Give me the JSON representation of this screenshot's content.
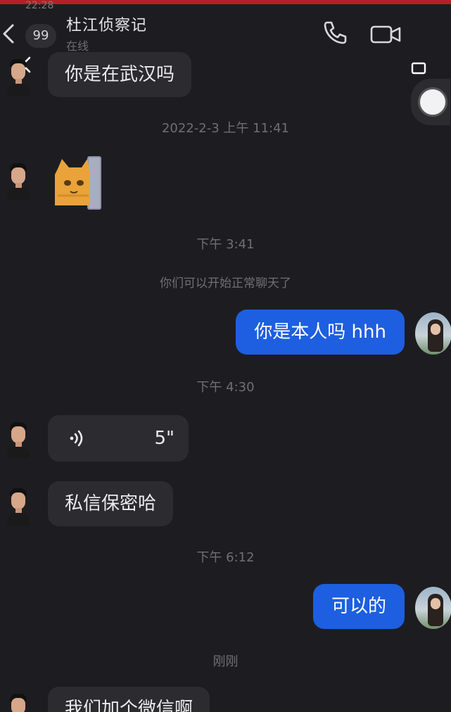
{
  "status": {
    "time": "22:28"
  },
  "header": {
    "back_label": "<",
    "unread_count": "99",
    "title": "杜江侦察记",
    "subtitle": "在线"
  },
  "icons": {
    "back": "chevron-left-icon",
    "call": "phone-icon",
    "video": "video-camera-icon",
    "more": "more-icon",
    "float": "floating-window-icon"
  },
  "colors": {
    "background": "#1d1d21",
    "incoming_bubble": "#2b2b30",
    "outgoing_bubble": "#1d5fe0",
    "accent_top": "#b32025"
  },
  "messages": [
    {
      "type": "text",
      "side": "in",
      "text": "你是在武汉吗"
    },
    {
      "type": "timestamp",
      "text": "2022-2-3 上午 11:41"
    },
    {
      "type": "sticker",
      "side": "in",
      "sticker": "orange-cat-sticker"
    },
    {
      "type": "timestamp",
      "text": "下午 3:41"
    },
    {
      "type": "notice",
      "text": "你们可以开始正常聊天了"
    },
    {
      "type": "text",
      "side": "out",
      "text": "你是本人吗 hhh"
    },
    {
      "type": "timestamp",
      "text": "下午 4:30"
    },
    {
      "type": "voice",
      "side": "in",
      "duration": "5\""
    },
    {
      "type": "text",
      "side": "in",
      "text": "私信保密哈"
    },
    {
      "type": "timestamp",
      "text": "下午 6:12"
    },
    {
      "type": "text",
      "side": "out",
      "text": "可以的"
    },
    {
      "type": "timestamp",
      "text": "刚刚"
    },
    {
      "type": "text",
      "side": "in",
      "text": "我们加个微信啊"
    }
  ]
}
